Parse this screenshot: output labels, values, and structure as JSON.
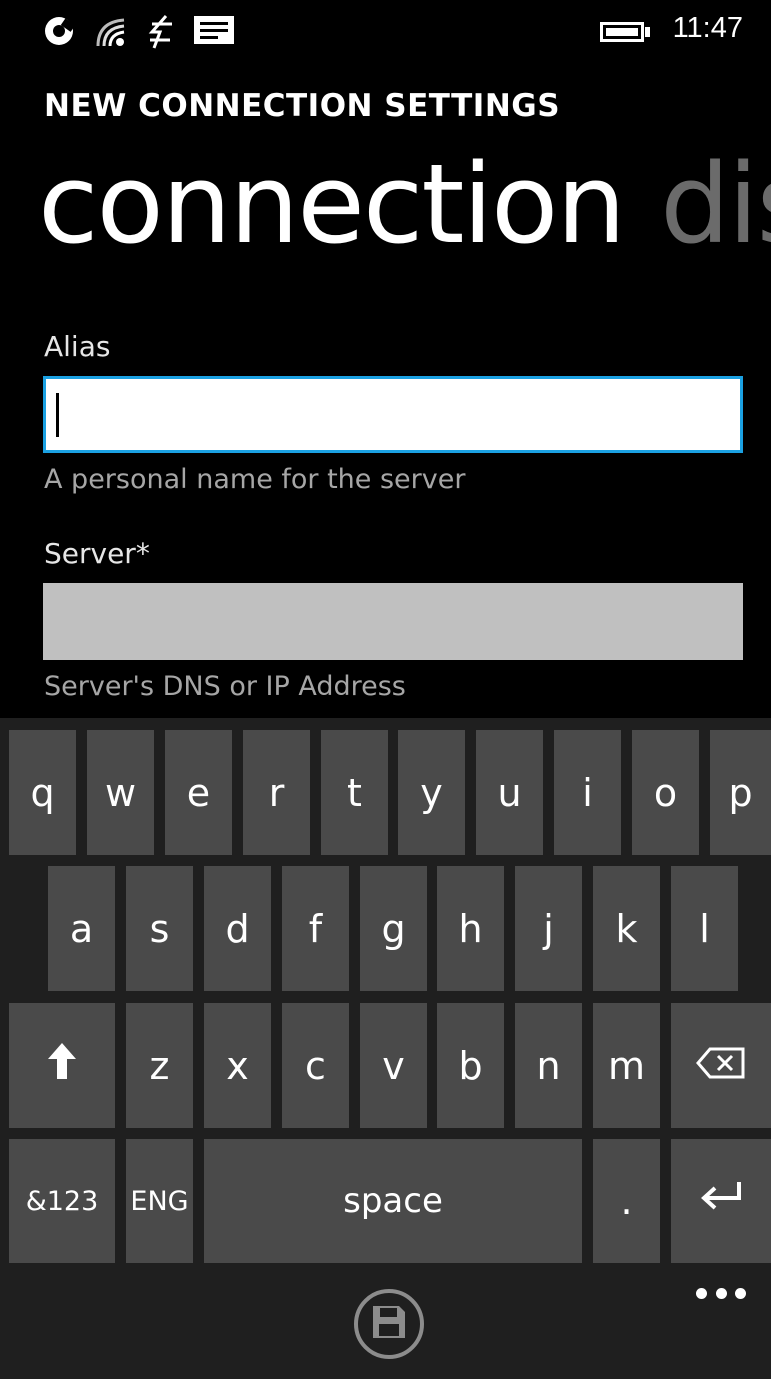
{
  "status_bar": {
    "time": "11:47",
    "icons": [
      "sync-icon",
      "wifi-icon",
      "data-icon",
      "message-icon",
      "battery-icon"
    ]
  },
  "header": {
    "app_title": "NEW CONNECTION SETTINGS",
    "pivot_active": "connection",
    "pivot_next": "dis"
  },
  "form": {
    "alias": {
      "label": "Alias",
      "value": "",
      "placeholder": "",
      "hint": "A personal name for the server"
    },
    "server": {
      "label": "Server*",
      "value": "",
      "placeholder": "",
      "hint": "Server's DNS or IP Address"
    }
  },
  "keyboard": {
    "row1": [
      "q",
      "w",
      "e",
      "r",
      "t",
      "y",
      "u",
      "i",
      "o",
      "p"
    ],
    "row2": [
      "a",
      "s",
      "d",
      "f",
      "g",
      "h",
      "j",
      "k",
      "l"
    ],
    "row3": [
      "z",
      "x",
      "c",
      "v",
      "b",
      "n",
      "m"
    ],
    "numbers_key": "&123",
    "language_key": "ENG",
    "space_key": "space",
    "period_key": "."
  },
  "app_bar": {
    "primary_icon": "save-icon",
    "more_icon": "more-icon"
  },
  "colors": {
    "accent": "#1ba1e2",
    "background": "#000000",
    "key": "#4a4a4a",
    "keyboard_bg": "#1f1f1f",
    "disabled_field": "#c0c0c0",
    "hint_text": "#a6a6a6",
    "inactive_pivot": "#6b6b6b"
  }
}
